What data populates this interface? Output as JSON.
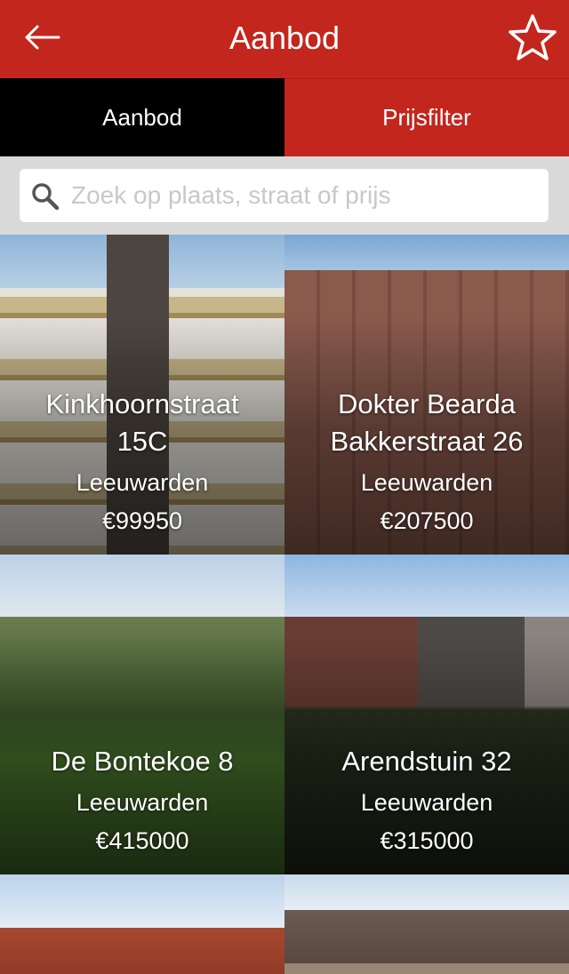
{
  "header": {
    "title": "Aanbod",
    "back_icon": "arrow-left-icon",
    "favorite_icon": "star-outline-icon",
    "background": "#c3261c"
  },
  "tabs": [
    {
      "label": "Aanbod",
      "active": true
    },
    {
      "label": "Prijsfilter",
      "active": false
    }
  ],
  "search": {
    "placeholder": "Zoek op plaats, straat of prijs",
    "icon": "search-icon"
  },
  "listings": [
    {
      "street": "Kinkhoornstraat 15C",
      "city": "Leeuwarden",
      "price": "€99950"
    },
    {
      "street": "Dokter Bearda Bakkerstraat 26",
      "city": "Leeuwarden",
      "price": "€207500"
    },
    {
      "street": "De Bontekoe 8",
      "city": "Leeuwarden",
      "price": "€415000"
    },
    {
      "street": "Arendstuin 32",
      "city": "Leeuwarden",
      "price": "€315000"
    }
  ],
  "colors": {
    "accent": "#c3261c",
    "tab_active": "#000000",
    "search_bg": "#d9d9d9"
  }
}
